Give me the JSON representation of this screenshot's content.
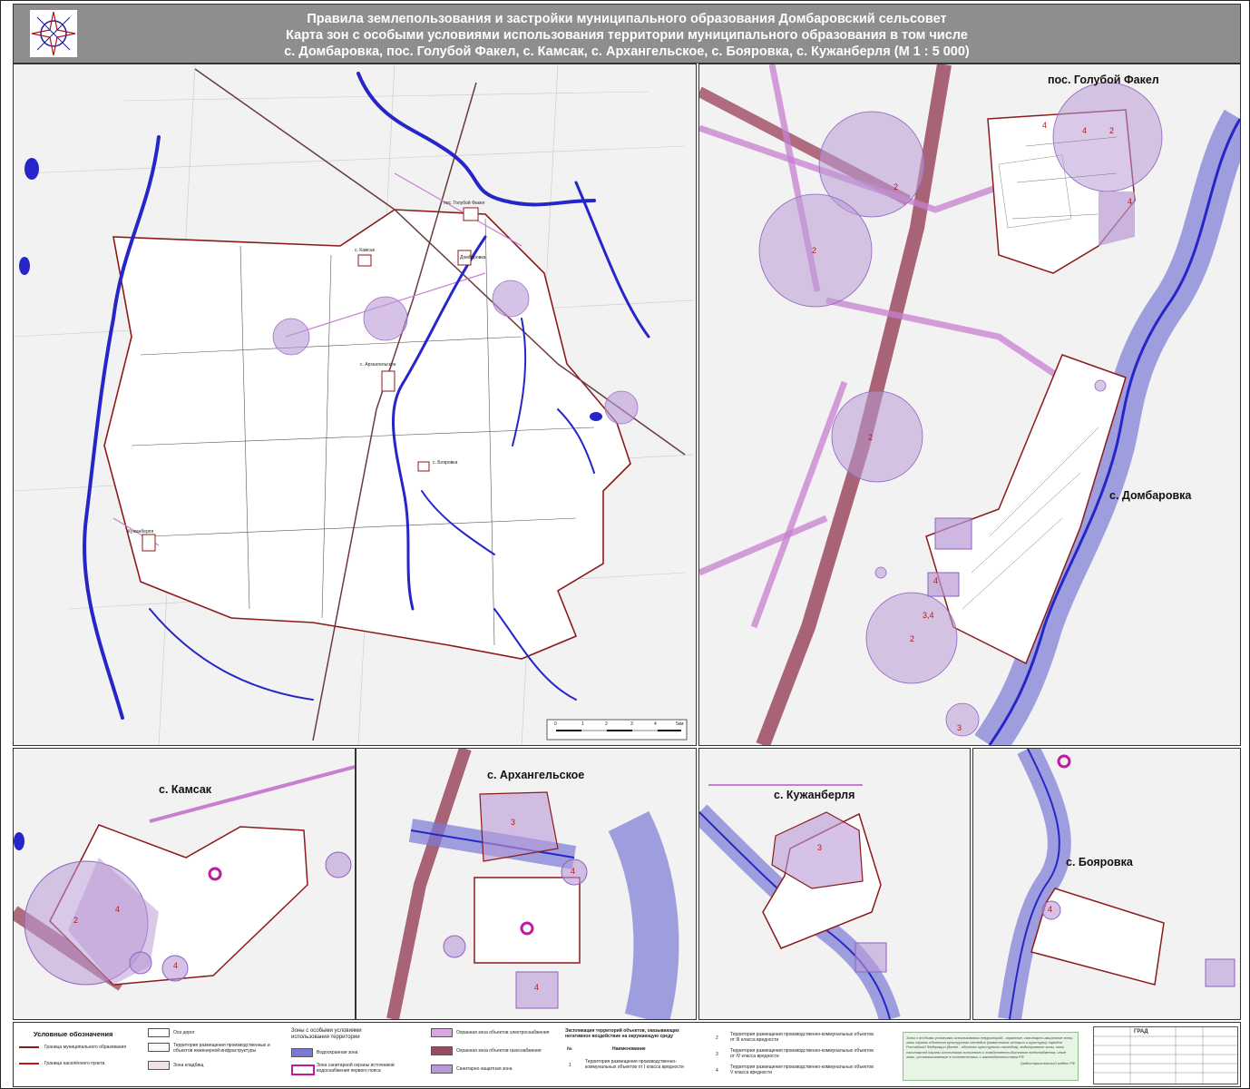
{
  "header": {
    "line1": "Правила землепользования и застройки муниципального образования Домбаровский сельсовет",
    "line2": "Карта зон с особыми условиями использования территории  муниципального образования в том числе",
    "line3": "с. Домбаровка, пос. Голубой Факел, с. Камсак, с. Архангельское, с. Бояровка, с. Кужанберля (М 1 : 5 000)"
  },
  "overview": {
    "settlements": [
      "пос. Голубой Факел",
      "с. Камсак",
      "Домбаровка",
      "с. Архангельское",
      "с. Бояровка",
      "Кужанберля"
    ],
    "scale_ticks": [
      "0",
      "1",
      "2",
      "3",
      "4",
      "5км"
    ]
  },
  "panels": {
    "golfak_dombar": {
      "label_top": "пос. Голубой Факел",
      "label_right": "с. Домбаровка",
      "zones": [
        "2",
        "2",
        "2",
        "4",
        "4",
        "2",
        "4",
        "4",
        "3,4",
        "2",
        "3"
      ]
    },
    "kamsak": {
      "label": "с. Камсак",
      "zones": [
        "2",
        "4",
        "4"
      ]
    },
    "arkhang": {
      "label": "с.  Архангельское",
      "zones": [
        "3",
        "4",
        "4"
      ]
    },
    "kuzhan": {
      "label": "с. Кужанберля",
      "zones": [
        "3"
      ]
    },
    "boyar": {
      "label": "с. Бояровка",
      "zones": [
        "4"
      ]
    }
  },
  "legend": {
    "title1": "Условные обозначения",
    "item_mo": "Граница муниципального образования",
    "item_np": "Граница населённого пункта",
    "item_roads": "Оси дорог",
    "item_prod": "Территория размещения производственных и объектов инженерной инфраструктуры",
    "item_cem": "Зона кладбищ",
    "title2": "Зоны с особыми условиями использования территории",
    "item_water": "Водоохранная зона",
    "item_sanit": "Зона санитарной охраны источников водоснабжения  первого пояса",
    "item_elec": "Охранная зона объектов электроснабжения",
    "item_gas": "Охранная зона  объектов газоснабжения",
    "item_szz": "Санитарно-защитная зона",
    "expl_title": "Экспликация территорий объектов, оказывающих негативное воздействие на окружающую среду",
    "col_num": "№",
    "col_name": "Наименование",
    "expl": [
      {
        "n": "1",
        "t": "Территория размещения производственно-коммунальных объектов от I класса вредности"
      },
      {
        "n": "2",
        "t": "Территория размещения производственно-коммунальных объектов от III класса вредности"
      },
      {
        "n": "3",
        "t": "Территория размещения производственно-коммунальных объектов от IV класса вредности"
      },
      {
        "n": "4",
        "t": "Территория размещения производственно-коммунальных объектов  V класса вредности"
      }
    ],
    "note": "Зоны с особыми условиями использования территорий - охранные, санитарно-защитные зоны, зоны охраны объектов культурного наследия (памятников истории и культуры) народов Российской Федерации (далее - объекты культурного наследия), водоохранные зоны, зоны санитарной охраны источников питьевого и хозяйственно-бытового водоснабжения, иные зоны, устанавливаемые в соответствии с законодательством РФ",
    "note_org": "Градостроительный кодекс РФ"
  },
  "stamp": {
    "org": "ГРАД"
  },
  "colors": {
    "boundary": "#8b1a1a",
    "water": "#2626c8",
    "water_zone": "#7a7ad6",
    "elec": "#c77fd0",
    "szz": "#b99ad6",
    "gas": "#9c4a60",
    "road": "#555555"
  }
}
